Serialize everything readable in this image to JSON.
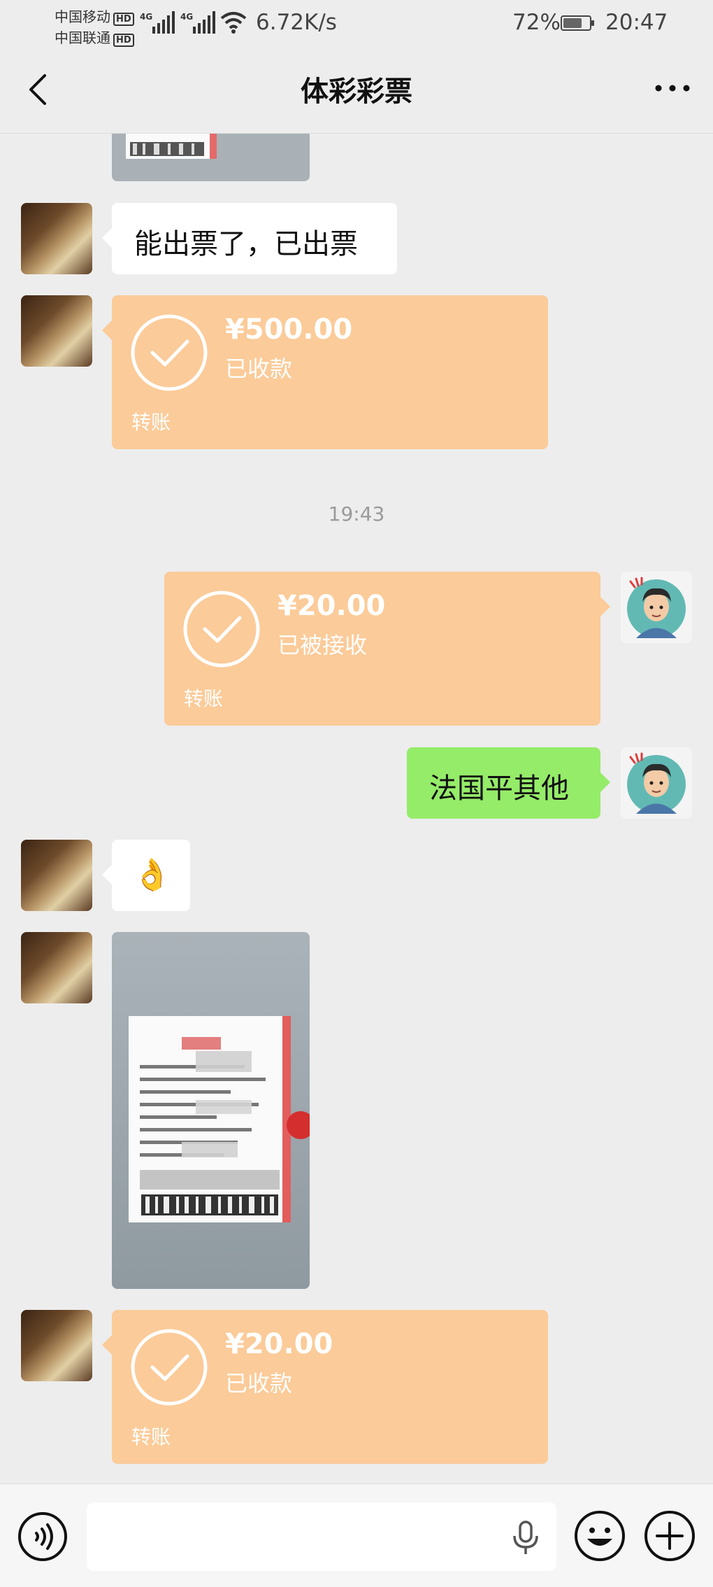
{
  "status_bar": {
    "carrier_1": "中国移动",
    "carrier_2": "中国联通",
    "hd_1": "HD",
    "hd_2": "HD",
    "network_1": "4G",
    "network_2": "4G",
    "net_speed": "6.72K/s",
    "battery_percent": "72%",
    "battery_level": 0.72,
    "time": "20:47"
  },
  "header": {
    "title": "体彩彩票",
    "back_icon": "chevron-left-icon",
    "more_icon": "more-dots-icon"
  },
  "messages": {
    "text_1": "能出票了，已出票",
    "transfer_1": {
      "amount": "¥500.00",
      "status": "已收款",
      "type": "转账"
    },
    "timestamp": "19:43",
    "transfer_2": {
      "amount": "¥20.00",
      "status": "已被接收",
      "type": "转账"
    },
    "text_2": "法国平其他",
    "emoji_1": "👌",
    "transfer_3": {
      "amount": "¥20.00",
      "status": "已收款",
      "type": "转账"
    }
  },
  "input_bar": {
    "voice_icon": "voice-mode-icon",
    "mic_icon": "microphone-icon",
    "emoji_icon": "emoji-icon",
    "plus_icon": "plus-icon",
    "input_value": ""
  },
  "colors": {
    "background": "#ededed",
    "transfer_bubble": "#fbcb99",
    "sent_bubble": "#95ec69",
    "received_bubble": "#ffffff"
  }
}
